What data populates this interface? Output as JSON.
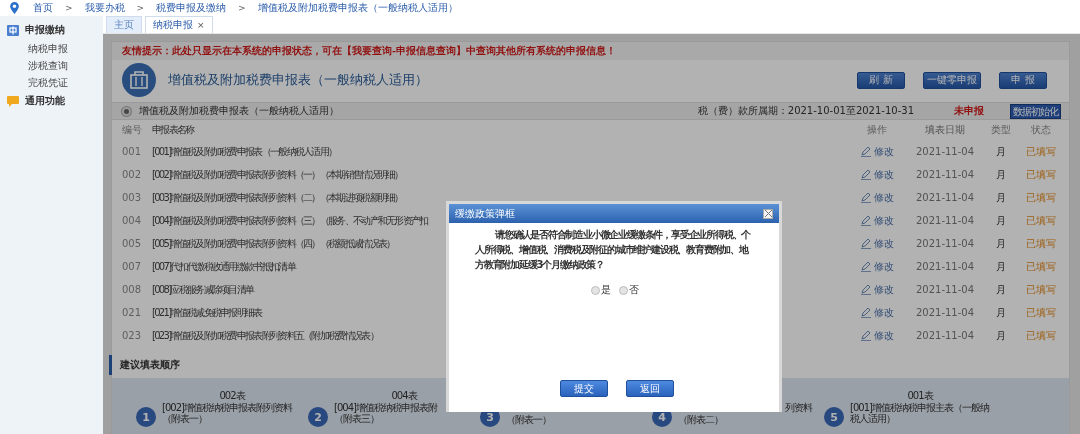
{
  "breadcrumb": {
    "separator": ">",
    "items": [
      "首页",
      "我要办税",
      "税费申报及缴纳",
      "增值税及附加税费申报表（一般纳税人适用）"
    ]
  },
  "sidebar": {
    "groups": [
      {
        "label": "申报缴纳",
        "kind": "tax",
        "children": [
          {
            "label": "纳税申报"
          },
          {
            "label": "涉税查询"
          },
          {
            "label": "完税凭证"
          }
        ]
      },
      {
        "label": "通用功能",
        "kind": "chat"
      }
    ]
  },
  "tabs": [
    {
      "label": "主页",
      "selected": false
    },
    {
      "label": "纳税申报",
      "selected": true,
      "close": "×"
    }
  ],
  "notice": "友情提示：此处只显示在本系统的申报状态，可在【我要查询-申报信息查询】中查询其他所有系统的申报信息！",
  "form_title": "增值税及附加税费申报表（一般纳税人适用）",
  "actions": [
    "刷 新",
    "一键零申报",
    "申 报"
  ],
  "form_bar": {
    "selected": true,
    "name": "增值税及附加税费申报表（一般纳税人适用）",
    "period": "税（费）款所属期：2021-10-01至2021-10-31",
    "status": "未申报",
    "init_button": "数据初始化"
  },
  "table": {
    "columns": [
      "编号",
      "申报表名称",
      "操作",
      "填表日期",
      "类型",
      "状态"
    ],
    "rows": [
      {
        "code": "001",
        "name": "[001]增值税及附加税费申报表（一般纳税人适用）",
        "action": "修改",
        "date": "2021-11-04",
        "type": "月",
        "status": "已填写"
      },
      {
        "code": "002",
        "name": "[002]增值税及附加税费申报表附列资料（一）（本期销售情况明细）",
        "action": "修改",
        "date": "2021-11-04",
        "type": "月",
        "status": "已填写"
      },
      {
        "code": "003",
        "name": "[003]增值税及附加税费申报表附列资料（二）（本期进项税额明细）",
        "action": "修改",
        "date": "2021-11-04",
        "type": "月",
        "status": "已填写"
      },
      {
        "code": "004",
        "name": "[004]增值税及附加税费申报表附列资料（三）（服务、不动产和无形资产扣",
        "action": "修改",
        "date": "2021-11-04",
        "type": "月",
        "status": "已填写"
      },
      {
        "code": "005",
        "name": "[005]增值税及附加税费申报表附列资料（四）（税额抵减情况表）",
        "action": "修改",
        "date": "2021-11-04",
        "type": "月",
        "status": "已填写"
      },
      {
        "code": "007",
        "name": "[007]代扣代缴税收通用缴款书抵扣清单",
        "action": "修改",
        "date": "2021-11-04",
        "type": "月",
        "status": "已填写"
      },
      {
        "code": "008",
        "name": "[008]应税服务减除项目清单",
        "action": "修改",
        "date": "2021-11-04",
        "type": "月",
        "status": "已填写"
      },
      {
        "code": "021",
        "name": "[021]增值税减免税申报明细表",
        "action": "修改",
        "date": "2021-11-04",
        "type": "月",
        "status": "已填写"
      },
      {
        "code": "023",
        "name": "[023]增值税及附加税费申报表附列资料五（附加税费情况表）",
        "action": "修改",
        "date": "2021-11-04",
        "type": "月",
        "status": "已填写"
      }
    ]
  },
  "order_section": {
    "title": "建议填表顺序",
    "steps": [
      {
        "num": "1",
        "code": "002表",
        "lines": [
          "[002]增值税纳税申报表附列资料",
          "（附表一）"
        ],
        "partial": false
      },
      {
        "num": "2",
        "code": "004表",
        "lines": [
          "[004]增值税纳税申报表附",
          "（附表三）"
        ],
        "partial": false
      },
      {
        "num": "3",
        "lines": [
          "（附表一）"
        ],
        "partial": true
      },
      {
        "num": "4",
        "lines": [
          "列资料",
          "（附表二）"
        ],
        "partial": true
      },
      {
        "num": "5",
        "code": "001表",
        "lines": [
          "[001]增值税纳税申报主表（一般纳",
          "税人适用）"
        ],
        "partial": false
      }
    ]
  },
  "modal": {
    "title": "缓缴政策弹框",
    "question": "请您确认是否符合制造业小微企业缓缴条件，享受企业所得税、个人所得税、增值税、消费税及附征的城市维护建设税、教育费附加、地方教育附加延缓3个月缴纳政策？",
    "options": [
      {
        "label": "是",
        "selected": false
      },
      {
        "label": "否",
        "selected": false
      }
    ],
    "buttons": [
      "提交",
      "返回"
    ]
  }
}
